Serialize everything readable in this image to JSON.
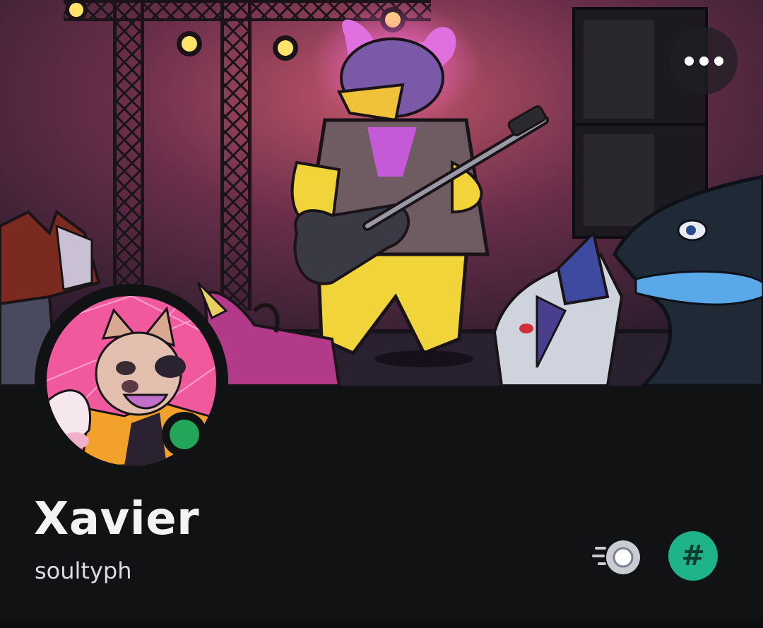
{
  "profile": {
    "display_name": "Xavier",
    "username": "soultyph",
    "status": "online"
  },
  "header": {
    "more_button_icon": "more-options-icon"
  },
  "badges": [
    {
      "name": "nitro-badge",
      "icon": "nitro-icon"
    },
    {
      "name": "hashtag-badge",
      "icon": "hashtag-icon",
      "glyph": "#"
    }
  ],
  "colors": {
    "background": "#111214",
    "status_online": "#23a55a",
    "hashtag_badge_bg": "#1fb38a",
    "hashtag_badge_fg": "#0e3b30",
    "nitro_badge": "#c9cdd3"
  }
}
